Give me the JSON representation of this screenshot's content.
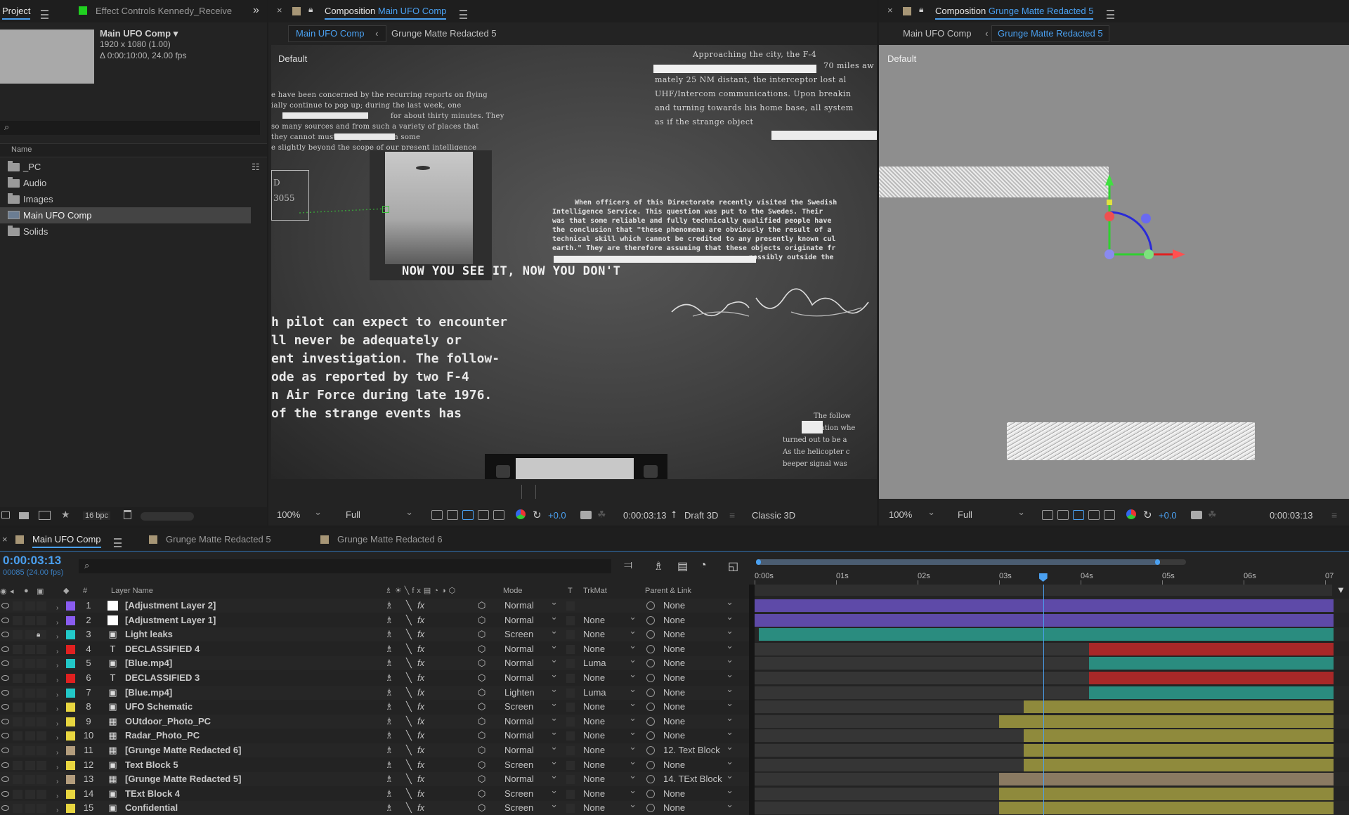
{
  "project_panel": {
    "tab_project": "Project",
    "tab_effect_controls": "Effect Controls Kennedy_Receive",
    "comp_name": "Main UFO Comp ▾",
    "comp_res": "1920 x 1080 (1.00)",
    "comp_dur": "Δ 0:00:10:00, 24.00 fps",
    "col_name": "Name",
    "items": [
      {
        "label": "_PC"
      },
      {
        "label": "Audio"
      },
      {
        "label": "Images"
      },
      {
        "label": "Main UFO Comp"
      },
      {
        "label": "Solids"
      }
    ],
    "bpc": "16 bpc"
  },
  "viewer_left": {
    "title_prefix": "Composition",
    "title_comp": "Main UFO Comp",
    "crumb_active": "Main UFO Comp",
    "crumb_next": "Grunge Matte Redacted 5",
    "view_label": "Default",
    "caption": "NOW YOU SEE IT, NOW YOU DON'T",
    "doc_lines_top": [
      "Approaching the city, the F-4",
      "70 miles aw",
      "mately 25 NM distant, the interceptor lost al",
      "UHF/Intercom communications. Upon breakin",
      "and turning towards his home base, all system",
      "as if the strange object"
    ],
    "doc_lines_left": [
      "e have been concerned by the recurring reports on flying",
      "ially continue to pop up; during the last week, one",
      "for about thirty minutes. They",
      "so many sources and from such a variety of places that",
      "they cannot        must be explained on some",
      "e slightly beyond the scope of our present intelligence"
    ],
    "doc_lines_mid": [
      "When officers of this Directorate recently visited the Swedish",
      "Intelligence Service. This question was put to the Swedes. Their",
      "was that some reliable and fully technically qualified people have",
      "the conclusion that \"these phenomena are obviously the result of a",
      "technical skill which cannot be credited to any presently known cul",
      "earth.\" They are therefore assuming that these objects originate fr",
      "possibly outside the"
    ],
    "doc_lines_big": [
      "h pilot can expect to encounter",
      "ll never be adequately or",
      "ent investigation. The follow-",
      "ode as reported by two F-4",
      "n Air Force during late 1976.",
      "of the strange events has"
    ],
    "doc_lines_right": [
      "The follow",
      "cation whe",
      "turned out to be a",
      "As the helicopter c",
      "beeper signal was"
    ],
    "stamp_text": "D 3055",
    "zoom": "100%",
    "quality": "Full",
    "exposure": "+0.0",
    "timecode": "0:00:03:13",
    "renderer": "Draft 3D",
    "view3d": "Classic 3D"
  },
  "viewer_right": {
    "title_prefix": "Composition",
    "title_comp": "Grunge Matte Redacted 5",
    "crumb_prev": "Main UFO Comp",
    "crumb_active": "Grunge Matte Redacted 5",
    "view_label": "Default",
    "zoom": "100%",
    "quality": "Full",
    "exposure": "+0.0",
    "timecode": "0:00:03:13"
  },
  "timeline": {
    "tabs": [
      {
        "label": "Main UFO Comp",
        "color": "#e5983c"
      },
      {
        "label": "Grunge Matte Redacted 5",
        "color": "#b39d7d"
      },
      {
        "label": "Grunge Matte Redacted 6",
        "color": "#b39d7d"
      }
    ],
    "current_time": "0:00:03:13",
    "frame_info": "00085 (24.00 fps)",
    "col_layer_name": "Layer Name",
    "col_num": "#",
    "col_mode": "Mode",
    "col_t": "T",
    "col_trkmat": "TrkMat",
    "col_parent": "Parent & Link",
    "ruler": [
      "0:00s",
      "01s",
      "02s",
      "03s",
      "04s",
      "05s",
      "06s",
      "07"
    ],
    "layers": [
      {
        "num": "1",
        "name": "[Adjustment Layer 2]",
        "label_color": "#8a5cf0",
        "type": "adj",
        "mode": "Normal",
        "trkmat": "",
        "parent": "None",
        "bar_color": "#5e4aa8"
      },
      {
        "num": "2",
        "name": "[Adjustment Layer 1]",
        "label_color": "#8a5cf0",
        "type": "adj",
        "mode": "Normal",
        "trkmat": "None",
        "parent": "None",
        "bar_color": "#5e4aa8"
      },
      {
        "num": "3",
        "name": "Light leaks",
        "label_color": "#22c8c8",
        "type": "img",
        "mode": "Screen",
        "trkmat": "None",
        "parent": "None",
        "bar_color": "#2a8c7f"
      },
      {
        "num": "4",
        "name": "DECLASSIFIED 4",
        "label_color": "#e02020",
        "type": "text",
        "mode": "Normal",
        "trkmat": "None",
        "parent": "None",
        "bar_color": "#a82828"
      },
      {
        "num": "5",
        "name": "[Blue.mp4]",
        "label_color": "#22c8c8",
        "type": "img",
        "mode": "Normal",
        "trkmat": "Luma",
        "parent": "None",
        "bar_color": "#2a8c7f"
      },
      {
        "num": "6",
        "name": "DECLASSIFIED 3",
        "label_color": "#e02020",
        "type": "text",
        "mode": "Normal",
        "trkmat": "None",
        "parent": "None",
        "bar_color": "#a82828"
      },
      {
        "num": "7",
        "name": "[Blue.mp4]",
        "label_color": "#22c8c8",
        "type": "img",
        "mode": "Lighten",
        "trkmat": "Luma",
        "parent": "None",
        "bar_color": "#2a8c7f"
      },
      {
        "num": "8",
        "name": "UFO Schematic",
        "label_color": "#e8d640",
        "type": "img",
        "mode": "Screen",
        "trkmat": "None",
        "parent": "None",
        "bar_color": "#8f8a3c"
      },
      {
        "num": "9",
        "name": "OUtdoor_Photo_PC",
        "label_color": "#e8d640",
        "type": "comp",
        "mode": "Normal",
        "trkmat": "None",
        "parent": "None",
        "bar_color": "#8f8a3c"
      },
      {
        "num": "10",
        "name": "Radar_Photo_PC",
        "label_color": "#e8d640",
        "type": "comp",
        "mode": "Normal",
        "trkmat": "None",
        "parent": "None",
        "bar_color": "#8f8a3c"
      },
      {
        "num": "11",
        "name": "[Grunge Matte Redacted 6]",
        "label_color": "#b39d7d",
        "type": "comp",
        "mode": "Normal",
        "trkmat": "None",
        "parent": "12. Text Block",
        "bar_color": "#8f8a3c"
      },
      {
        "num": "12",
        "name": "Text Block 5",
        "label_color": "#e8d640",
        "type": "img",
        "mode": "Screen",
        "trkmat": "None",
        "parent": "None",
        "bar_color": "#8f8a3c"
      },
      {
        "num": "13",
        "name": "[Grunge Matte Redacted 5]",
        "label_color": "#b39d7d",
        "type": "comp",
        "mode": "Normal",
        "trkmat": "None",
        "parent": "14. TExt Block",
        "bar_color": "#8a7a62"
      },
      {
        "num": "14",
        "name": "TExt Block 4",
        "label_color": "#e8d640",
        "type": "img",
        "mode": "Screen",
        "trkmat": "None",
        "parent": "None",
        "bar_color": "#8f8a3c"
      },
      {
        "num": "15",
        "name": "Confidential",
        "label_color": "#e8d640",
        "type": "img",
        "mode": "Screen",
        "trkmat": "None",
        "parent": "None",
        "bar_color": "#8f8a3c"
      }
    ],
    "bar_starts_seconds": [
      0,
      0,
      0.05,
      4.1,
      4.1,
      4.1,
      4.1,
      3.3,
      3.0,
      3.3,
      3.3,
      3.3,
      3.0,
      3.0,
      3.0
    ]
  }
}
